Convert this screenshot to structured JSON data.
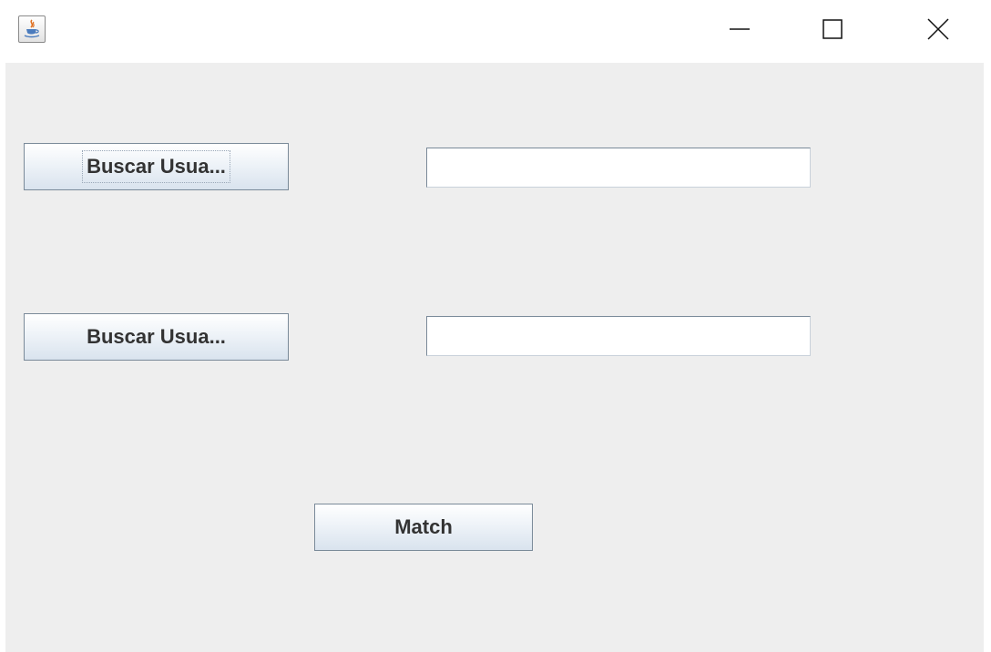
{
  "window": {
    "icon": "java-cup-icon",
    "controls": {
      "minimize_icon": "minimize-icon",
      "maximize_icon": "maximize-icon",
      "close_icon": "close-icon"
    }
  },
  "form": {
    "user1": {
      "button_label": "Buscar Usua...",
      "field_value": ""
    },
    "user2": {
      "button_label": "Buscar Usua...",
      "field_value": ""
    },
    "match_label": "Match"
  },
  "colors": {
    "content_background": "#eeeeee",
    "button_border": "#7a8a99",
    "button_text": "#333333"
  }
}
